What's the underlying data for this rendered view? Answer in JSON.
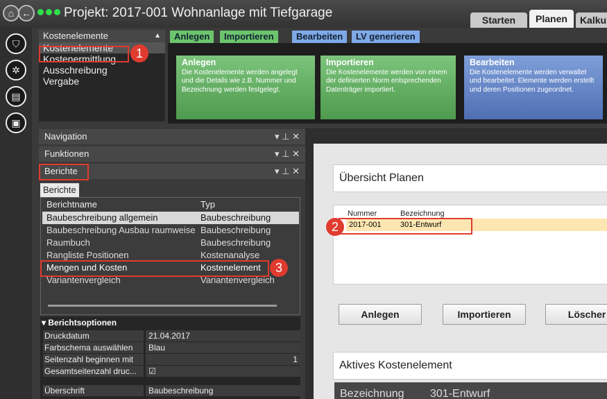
{
  "window": {
    "title": "Projekt: 2017-001 Wohnanlage mit Tiefgarage"
  },
  "top_tabs": [
    "Starten",
    "Planen",
    "Kalku"
  ],
  "menu": {
    "header": "Kostenelemente",
    "items": [
      "Kostenelemente",
      "Kostenermittlung",
      "Ausschreibung",
      "Vergabe"
    ]
  },
  "ribbon_tabs": [
    "Anlegen",
    "Importieren",
    "Bearbeiten",
    "LV generieren"
  ],
  "cards": [
    {
      "title": "Anlegen",
      "text": "Die Kostenelemente werden angelegt und die Details wie z.B. Nummer und Bezeichnung werden festgelegt."
    },
    {
      "title": "Importieren",
      "text": "Die Kostenelemente werden von einem der definierten Norm entsprechenden Datenträger importiert."
    },
    {
      "title": "Bearbeiten",
      "text": "Die Kostenelemente werden verwaltet und bearbeitet. Elemente werden erstellt und deren Positionen zugeordnet."
    }
  ],
  "panels": {
    "navigation": "Navigation",
    "funktionen": "Funktionen",
    "berichte": "Berichte",
    "controls": "▾ ⊥ ✕"
  },
  "reports": {
    "tab": "Berichte",
    "columns": [
      "Berichtname",
      "Typ"
    ],
    "rows": [
      [
        "Baubeschreibung allgemein",
        "Baubeschreibung"
      ],
      [
        "Baubeschreibung Ausbau raumweise",
        "Baubeschreibung"
      ],
      [
        "Raumbuch",
        "Baubeschreibung"
      ],
      [
        "Rangliste Positionen",
        "Kostenanalyse"
      ],
      [
        "Mengen und Kosten",
        "Kostenelement"
      ],
      [
        "Variantenvergleich",
        "Variantenvergleich"
      ]
    ]
  },
  "options": {
    "header": "▾ Berichtsoptionen",
    "rows": [
      [
        "Druckdatum",
        "21.04.2017"
      ],
      [
        "Farbschema auswählen",
        "Blau"
      ],
      [
        "Seitenzahl beginnen mit",
        "1"
      ],
      [
        "Gesamtseitenzahl druc...",
        "☑"
      ],
      [
        "Überschrift",
        "Baubeschreibung"
      ]
    ]
  },
  "overview": {
    "title": "Übersicht Planen",
    "columns": [
      "Nummer",
      "Bezeichnung"
    ],
    "row": [
      "2017-001",
      "301-Entwurf"
    ],
    "buttons": [
      "Anlegen",
      "Importieren",
      "Löscher"
    ]
  },
  "active": {
    "title": "Aktives Kostenelement",
    "label": "Bezeichnung",
    "value": "301-Entwurf"
  },
  "callouts": [
    "1",
    "2",
    "3"
  ],
  "colors": {
    "green": "#5aa85a",
    "blue": "#5b7fc4",
    "highlight": "#fde6b1",
    "callout": "#e03b2f"
  }
}
